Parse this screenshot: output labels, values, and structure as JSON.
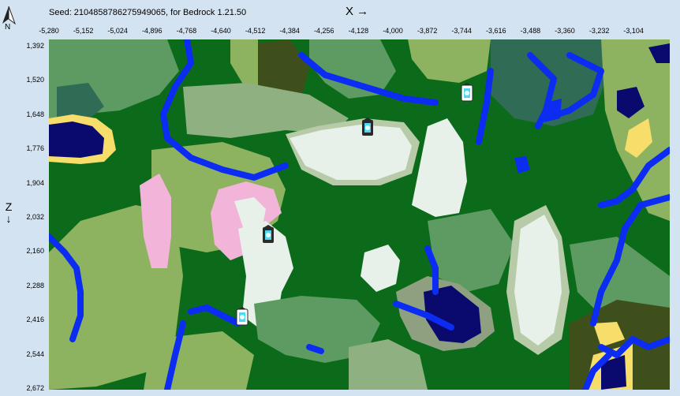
{
  "header": {
    "seed_text": "Seed: 2104858786275949065, for Bedrock 1.21.50",
    "x_axis_label": "X →",
    "z_axis_label": "Z ↓",
    "north_label": "N"
  },
  "x_ticks": [
    "-5,280",
    "-5,152",
    "-5,024",
    "-4,896",
    "-4,768",
    "-4,640",
    "-4,512",
    "-4,384",
    "-4,256",
    "-4,128",
    "-4,000",
    "-3,872",
    "-3,744",
    "-3,616",
    "-3,488",
    "-3,360",
    "-3,232",
    "-3,104"
  ],
  "z_ticks": [
    "1,392",
    "1,520",
    "1,648",
    "1,776",
    "1,904",
    "2,032",
    "2,160",
    "2,288",
    "2,416",
    "2,544",
    "2,672"
  ],
  "markers": [
    {
      "type": "trail-ruins-icon"
    },
    {
      "type": "trail-ruins-icon"
    },
    {
      "type": "trail-ruins-icon"
    },
    {
      "type": "trail-ruins-icon"
    }
  ],
  "colors": {
    "forest": "#0b6b1a",
    "river": "#0c2cf2",
    "plains": "#8db361",
    "meadow": "#5d9b62",
    "snowy": "#e8f0ea",
    "cherry": "#f2b4d8",
    "lake": "#0a0a6e",
    "dark_forest": "#3f4f1c",
    "beach": "#f7de6a",
    "taiga": "#2f6b55"
  }
}
